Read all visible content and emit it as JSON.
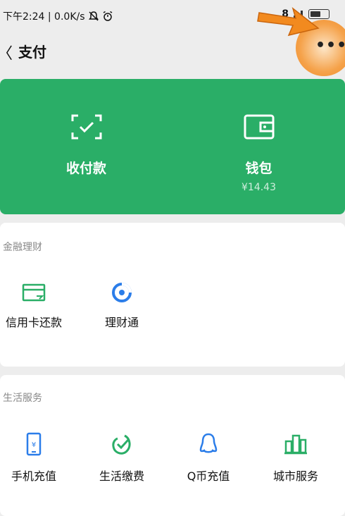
{
  "status": {
    "time_speed": "下午2:24 | 0.0K/s",
    "bluetooth_text": "8"
  },
  "header": {
    "back_glyph": "〈",
    "title": "支付",
    "more_glyph": "•••"
  },
  "green_card": {
    "items": [
      {
        "label": "收付款",
        "icon": "scan-icon"
      },
      {
        "label": "钱包",
        "sub": "¥14.43",
        "icon": "wallet-icon"
      }
    ]
  },
  "finance": {
    "title": "金融理财",
    "items": [
      {
        "label": "信用卡还款",
        "icon": "credit-card-icon"
      },
      {
        "label": "理财通",
        "icon": "wealth-icon"
      }
    ]
  },
  "life": {
    "title": "生活服务",
    "items": [
      {
        "label": "手机充值",
        "icon": "phone-icon"
      },
      {
        "label": "生活缴费",
        "icon": "check-leaf-icon"
      },
      {
        "label": "Q币充值",
        "icon": "penguin-icon"
      },
      {
        "label": "城市服务",
        "icon": "city-icon"
      }
    ]
  },
  "colors": {
    "green": "#2aae67",
    "background": "#ededed",
    "highlight": "#f08a28",
    "icon_blue": "#2b7de9"
  }
}
